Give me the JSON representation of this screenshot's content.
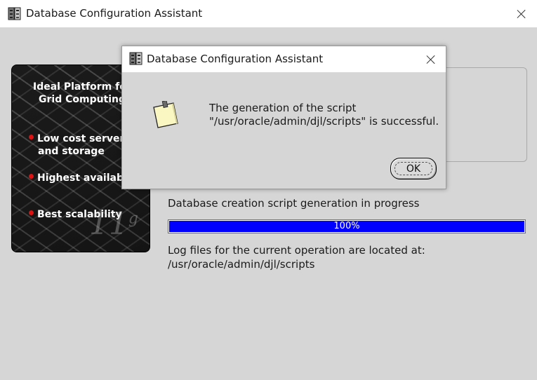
{
  "main_window": {
    "title": "Database Configuration Assistant",
    "icon": "database-app-icon"
  },
  "promo": {
    "title_line1": "Ideal Platform for",
    "title_line2": "Grid Computing",
    "bullets": [
      {
        "line1": "Low cost servers",
        "line2": "and storage"
      },
      {
        "line1": "Highest availability",
        "line2": ""
      },
      {
        "line1": "Best scalability",
        "line2": ""
      }
    ],
    "badge": "11",
    "badge_sup": "g"
  },
  "status": {
    "label": "Database creation script generation in progress",
    "progress_percent": 100,
    "progress_text": "100%",
    "log_line1": "Log files for the current operation are located at:",
    "log_line2": "/usr/oracle/admin/djl/scripts"
  },
  "dialog": {
    "title": "Database Configuration Assistant",
    "message_line1": "The generation of the script",
    "message_line2": "\"/usr/oracle/admin/djl/scripts\" is successful.",
    "ok_label": "OK",
    "icon": "note-icon"
  },
  "colors": {
    "progress": "#0000ff",
    "background": "#d6d6d6",
    "bullet": "#e01010"
  }
}
